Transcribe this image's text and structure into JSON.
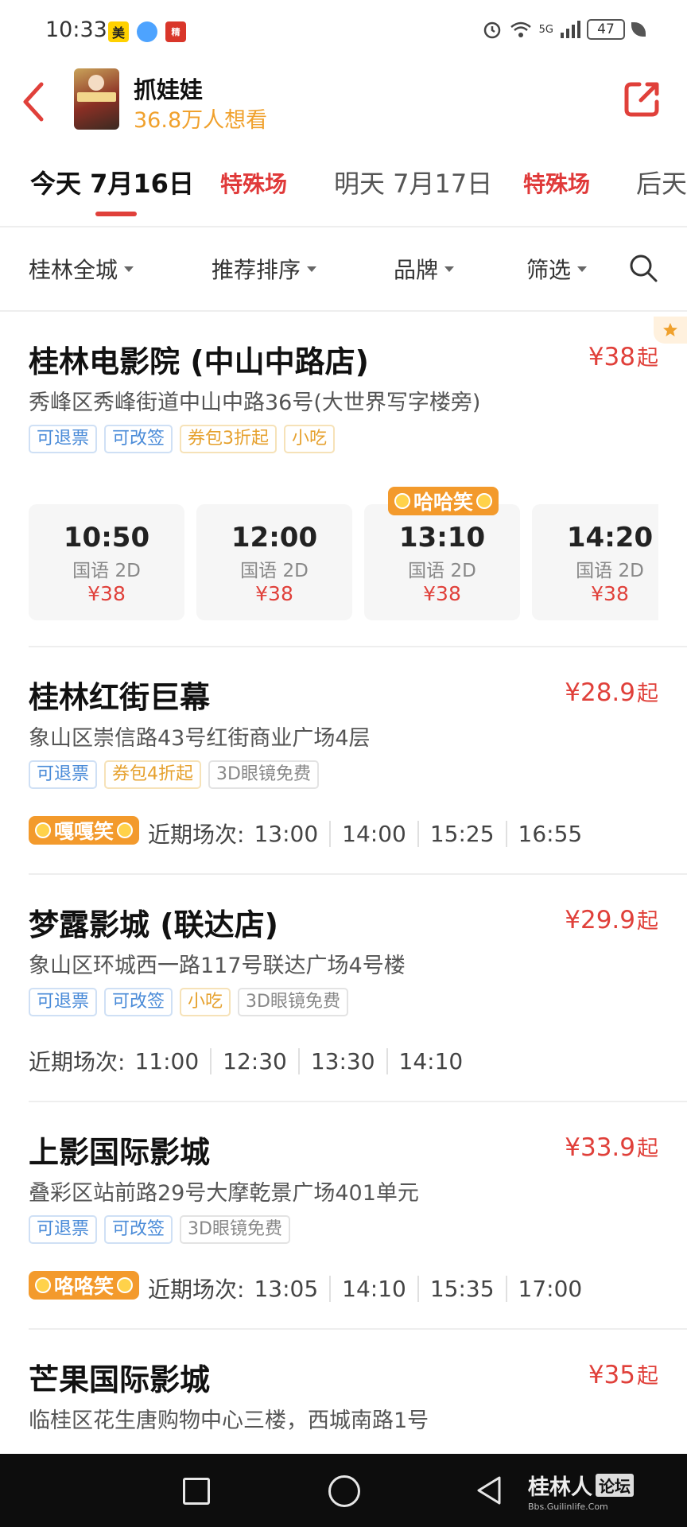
{
  "status_bar": {
    "time": "10:33",
    "app_icons": [
      "美",
      "",
      "精"
    ],
    "signal_label": "5G",
    "battery": "47"
  },
  "header": {
    "title": "抓娃娃",
    "want_to_see": "36.8万人想看"
  },
  "date_tabs": [
    {
      "label": "今天 7月16日",
      "badge": "特殊场",
      "active": true
    },
    {
      "label": "明天 7月17日",
      "badge": "特殊场",
      "active": false
    },
    {
      "label": "后天",
      "badge": "",
      "active": false
    }
  ],
  "filters": [
    {
      "label": "桂林全城"
    },
    {
      "label": "推荐排序"
    },
    {
      "label": "品牌"
    },
    {
      "label": "筛选"
    }
  ],
  "cinemas": [
    {
      "name": "桂林电影院 (中山中路店)",
      "price": "¥38",
      "price_suffix": "起",
      "address": "秀峰区秀峰街道中山中路36号(大世界写字楼旁)",
      "tags": [
        {
          "text": "可退票",
          "color": "blue"
        },
        {
          "text": "可改签",
          "color": "blue"
        },
        {
          "text": "券包3折起",
          "color": "orange"
        },
        {
          "text": "小吃",
          "color": "orange"
        }
      ],
      "showtimes": [
        {
          "time": "10:50",
          "lang": "国语 2D",
          "price": "¥38",
          "badge": ""
        },
        {
          "time": "12:00",
          "lang": "国语 2D",
          "price": "¥38",
          "badge": ""
        },
        {
          "time": "13:10",
          "lang": "国语 2D",
          "price": "¥38",
          "badge": "哈哈笑"
        },
        {
          "time": "14:20",
          "lang": "国语 2D",
          "price": "¥38",
          "badge": ""
        }
      ]
    },
    {
      "name": "桂林红街巨幕",
      "price": "¥28.9",
      "price_suffix": "起",
      "address": "象山区崇信路43号红街商业广场4层",
      "tags": [
        {
          "text": "可退票",
          "color": "blue"
        },
        {
          "text": "券包4折起",
          "color": "orange"
        },
        {
          "text": "3D眼镜免费",
          "color": "gray"
        }
      ],
      "badge": "嘎嘎笑",
      "recent_label": "近期场次:",
      "recent_times": [
        "13:00",
        "14:00",
        "15:25",
        "16:55"
      ]
    },
    {
      "name": "梦露影城 (联达店)",
      "price": "¥29.9",
      "price_suffix": "起",
      "address": "象山区环城西一路117号联达广场4号楼",
      "tags": [
        {
          "text": "可退票",
          "color": "blue"
        },
        {
          "text": "可改签",
          "color": "blue"
        },
        {
          "text": "小吃",
          "color": "orange"
        },
        {
          "text": "3D眼镜免费",
          "color": "gray"
        }
      ],
      "badge": "",
      "recent_label": "近期场次:",
      "recent_times": [
        "11:00",
        "12:30",
        "13:30",
        "14:10"
      ]
    },
    {
      "name": "上影国际影城",
      "price": "¥33.9",
      "price_suffix": "起",
      "address": "叠彩区站前路29号大摩乾景广场401单元",
      "tags": [
        {
          "text": "可退票",
          "color": "blue"
        },
        {
          "text": "可改签",
          "color": "blue"
        },
        {
          "text": "3D眼镜免费",
          "color": "gray"
        }
      ],
      "badge": "咯咯笑",
      "recent_label": "近期场次:",
      "recent_times": [
        "13:05",
        "14:10",
        "15:35",
        "17:00"
      ]
    },
    {
      "name": "芒果国际影城",
      "price": "¥35",
      "price_suffix": "起",
      "address": "临桂区花生唐购物中心三楼，西城南路1号"
    }
  ],
  "watermark": {
    "name": "桂林人",
    "box": "论坛",
    "url": "Bbs.Guilinlife.Com"
  },
  "colors": {
    "accent_red": "#e0403a",
    "orange": "#f39a2c",
    "blue_tag": "#4a8bd8"
  }
}
